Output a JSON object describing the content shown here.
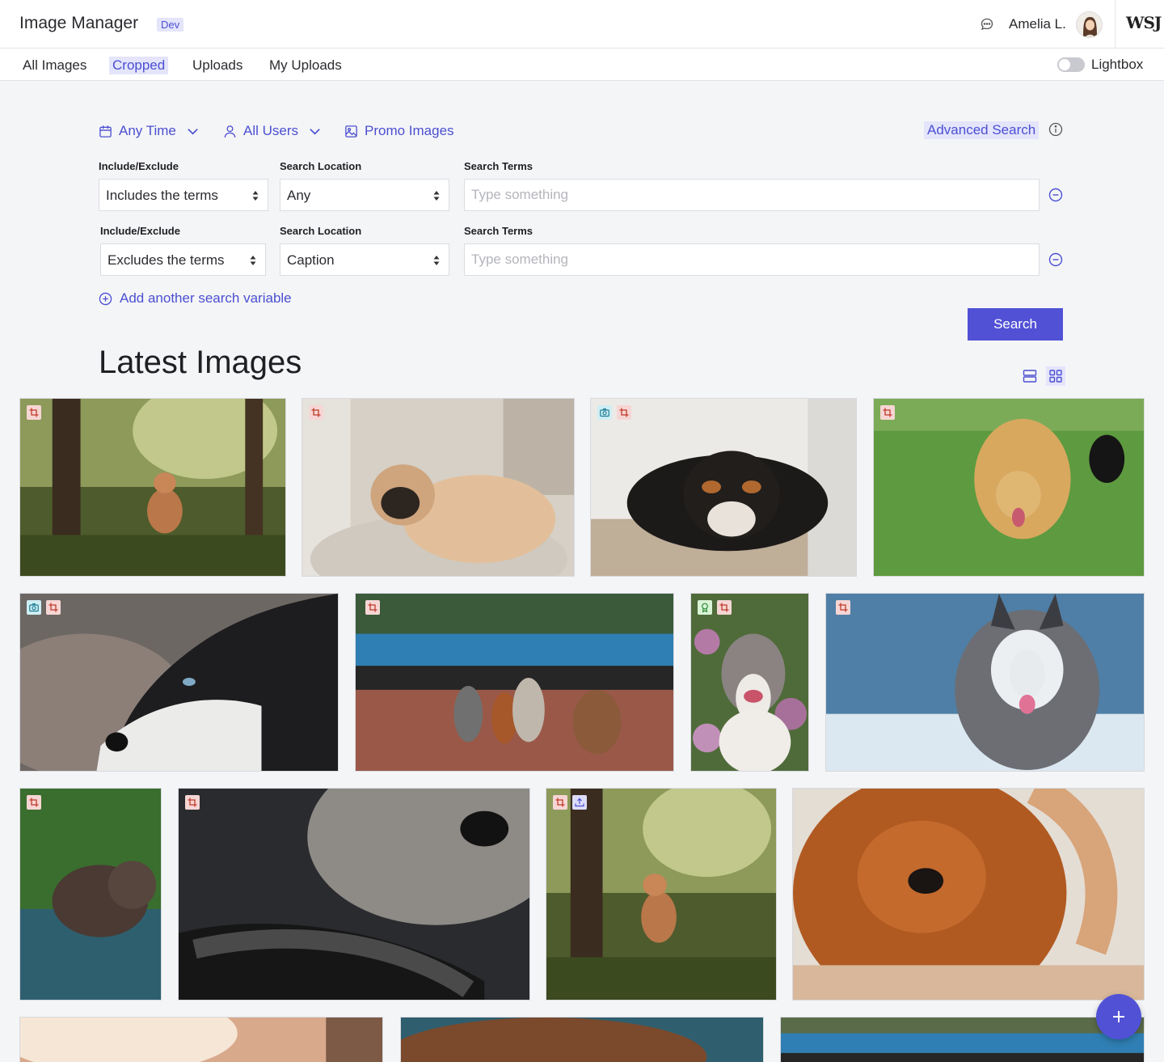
{
  "app": {
    "title": "Image Manager",
    "env_badge": "Dev",
    "brand_logo": "WSJ"
  },
  "user": {
    "name": "Amelia L."
  },
  "nav": {
    "tabs": [
      {
        "label": "All Images"
      },
      {
        "label": "Cropped",
        "active": true
      },
      {
        "label": "Uploads"
      },
      {
        "label": "My Uploads"
      }
    ]
  },
  "lightbox": {
    "label": "Lightbox",
    "enabled": false
  },
  "filters": {
    "time": "Any Time",
    "users": "All Users",
    "promo": "Promo Images"
  },
  "advanced_search": {
    "label": "Advanced Search"
  },
  "search_rows": [
    {
      "include_label": "Include/Exclude",
      "include_value": "Includes the terms",
      "location_label": "Search Location",
      "location_value": "Any",
      "terms_label": "Search Terms",
      "terms_value": "",
      "terms_placeholder": "Type something"
    },
    {
      "include_label": "Include/Exclude",
      "include_value": "Excludes the terms",
      "location_label": "Search Location",
      "location_value": "Caption",
      "terms_label": "Search Terms",
      "terms_value": "",
      "terms_placeholder": "Type something"
    }
  ],
  "add_variable": {
    "label": "Add another search variable"
  },
  "search_button": {
    "label": "Search"
  },
  "latest": {
    "title": "Latest Images",
    "view_mode": "grid"
  },
  "images": [
    {
      "subject": "shiba dog in forest",
      "badges": [
        "crop-icon"
      ]
    },
    {
      "subject": "pug on couch",
      "badges": [
        "crop-icon"
      ]
    },
    {
      "subject": "black and tan dog lying on floor",
      "badges": [
        "camera-icon",
        "crop-icon"
      ]
    },
    {
      "subject": "golden retriever on grass",
      "badges": [
        "crop-icon"
      ]
    },
    {
      "subject": "husky profile close-up",
      "badges": [
        "camera-icon",
        "crop-icon"
      ]
    },
    {
      "subject": "dogs on leashes in park",
      "badges": [
        "crop-icon"
      ]
    },
    {
      "subject": "pit bull among flowers",
      "badges": [
        "award-icon",
        "crop-icon"
      ]
    },
    {
      "subject": "husky in snow",
      "badges": [
        "crop-icon"
      ]
    },
    {
      "subject": "curly dog in water",
      "badges": [
        "crop-icon"
      ]
    },
    {
      "subject": "dog wearing harness",
      "badges": [
        "crop-icon"
      ]
    },
    {
      "subject": "shiba dog in forest",
      "badges": [
        "crop-icon",
        "upload-icon"
      ]
    },
    {
      "subject": "chow chow close-up",
      "badges": []
    },
    {
      "subject": "sunlit dog",
      "badges": []
    },
    {
      "subject": "brown dog",
      "badges": []
    },
    {
      "subject": "dog walking in park",
      "badges": []
    }
  ],
  "colors": {
    "accent": "#5151d6",
    "accent_soft": "#e4e5fb",
    "crop_badge": "#f6d6d4",
    "camera_badge": "#cfeef4",
    "award_badge": "#d9f3d6",
    "upload_badge": "#dcdcf7"
  }
}
